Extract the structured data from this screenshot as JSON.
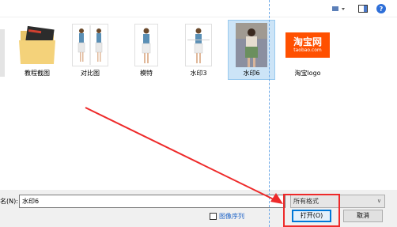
{
  "files": [
    {
      "label": "教程截图",
      "icon": "folder-icon"
    },
    {
      "label": "对比图",
      "icon": "image-thumb-icon"
    },
    {
      "label": "模特",
      "icon": "image-thumb-icon"
    },
    {
      "label": "水印3",
      "icon": "image-thumb-icon"
    },
    {
      "label": "水印6",
      "icon": "image-thumb-icon",
      "selected": true
    },
    {
      "label": "淘宝logo",
      "icon": "image-thumb-icon"
    }
  ],
  "logo_thumb": {
    "line1": "淘宝网",
    "line2": "taobao.com",
    "color": "#ff5000"
  },
  "bottom": {
    "filename_label": "名(N):",
    "filename_value": "水印6",
    "filetype_value": "所有格式",
    "checkbox_label": "图像序列",
    "open_label": "打开(O)",
    "cancel_label": "取消"
  },
  "colors": {
    "accent": "#0078d7",
    "annotation": "#ee2a2a",
    "selection": "#cce4f7"
  }
}
